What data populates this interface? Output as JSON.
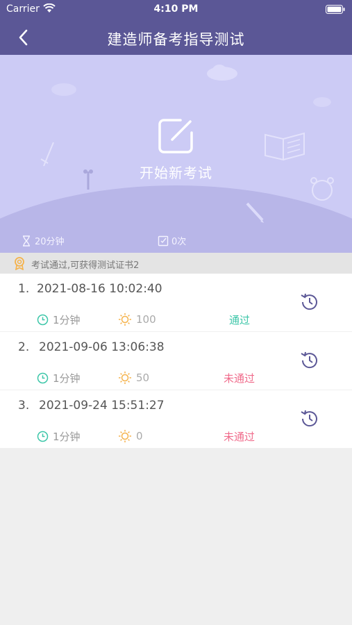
{
  "statusbar": {
    "carrier": "Carrier",
    "time": "4:10 PM"
  },
  "navbar": {
    "title": "建造师备考指导测试"
  },
  "hero": {
    "start_label": "开始新考试",
    "duration": "20分钟",
    "attempts": "0次"
  },
  "notice": {
    "text": "考试通过,可获得测试证书2"
  },
  "colors": {
    "header": "#5b5796",
    "hero": "#cccbf5",
    "pass": "#3cc6a8",
    "fail": "#f06b8b",
    "clock": "#3cc6a8",
    "score": "#f5b24a"
  },
  "records": [
    {
      "index": "1.",
      "datetime": "2021-08-16 10:02:40",
      "duration": "1分钟",
      "score": "100",
      "status": "通过",
      "passed": true
    },
    {
      "index": "2.",
      "datetime": "2021-09-06 13:06:38",
      "duration": "1分钟",
      "score": "50",
      "status": "未通过",
      "passed": false
    },
    {
      "index": "3.",
      "datetime": "2021-09-24 15:51:27",
      "duration": "1分钟",
      "score": "0",
      "status": "未通过",
      "passed": false
    }
  ]
}
